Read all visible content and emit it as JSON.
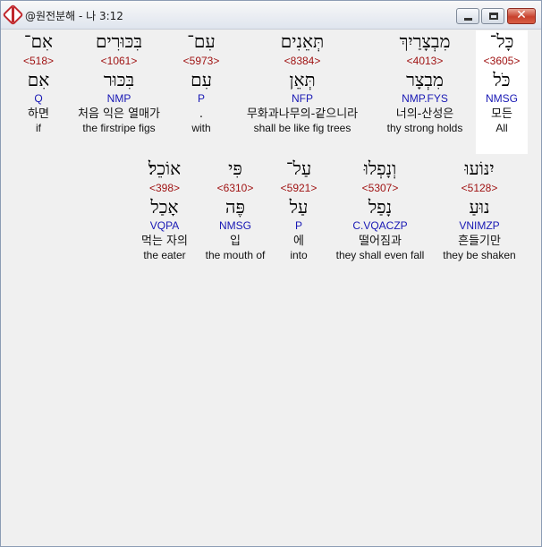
{
  "window": {
    "title": "@원전분해 - 나 3:12",
    "close_glyph": "✕"
  },
  "rows": [
    [
      {
        "hebrew": "כָּל־",
        "strong": "<3605>",
        "lemma": "כֹּל",
        "parse": "NMSG",
        "korean": "모든",
        "english": "All",
        "selected": true
      },
      {
        "hebrew": "מִבְצָרַיִךְ",
        "strong": "<4013>",
        "lemma": "מִבְצָר",
        "parse": "NMP.FYS",
        "korean": "너의-산성은",
        "english": "thy strong holds"
      },
      {
        "hebrew": "תְּאֵנִים",
        "strong": "<8384>",
        "lemma": "תְּאֵן",
        "parse": "NFP",
        "korean": "무화과나무의-같으니라",
        "english": "shall be like fig trees"
      },
      {
        "hebrew": "עִם־",
        "strong": "<5973>",
        "lemma": "עִם",
        "parse": "P",
        "korean": ".",
        "english": "with"
      },
      {
        "hebrew": "בִּכּוּרִים",
        "strong": "<1061>",
        "lemma": "בִּכּוּר",
        "parse": "NMP",
        "korean": "처음 익은 열매가",
        "english": "the firstripe figs"
      },
      {
        "hebrew": "אִם־",
        "strong": "<518>",
        "lemma": "אִם",
        "parse": "Q",
        "korean": "하면",
        "english": "if"
      }
    ],
    [
      {
        "hebrew": "יִנּוֹעוּ",
        "strong": "<5128>",
        "lemma": "נוּעַ",
        "parse": "VNIMZP",
        "korean": "흔들기만",
        "english": "they be shaken"
      },
      {
        "hebrew": "וְנָפְלוּ",
        "strong": "<5307>",
        "lemma": "נָפַל",
        "parse": "C.VQACZP",
        "korean": "떨어짐과",
        "english": "they shall even fall"
      },
      {
        "hebrew": "עַל־",
        "strong": "<5921>",
        "lemma": "עַל",
        "parse": "P",
        "korean": "에",
        "english": "into"
      },
      {
        "hebrew": "פִּי",
        "strong": "<6310>",
        "lemma": "פֶּה",
        "parse": "NMSG",
        "korean": "입",
        "english": "the mouth of"
      },
      {
        "hebrew": "אוֹכֵל׃",
        "strong": "<398>",
        "lemma": "אָכַל",
        "parse": "VQPA",
        "korean": "먹는 자의",
        "english": "the eater"
      }
    ]
  ]
}
